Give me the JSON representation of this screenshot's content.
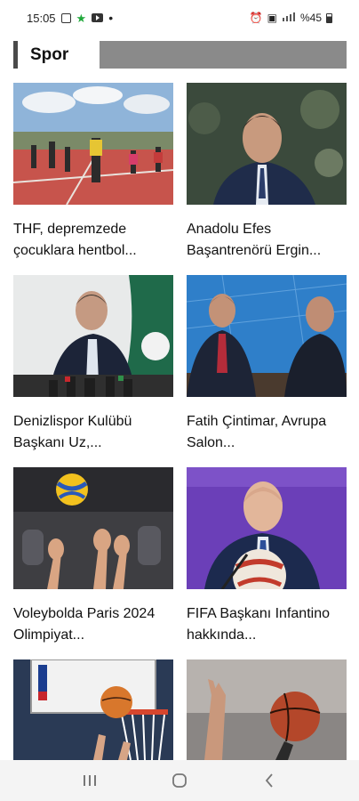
{
  "status_bar": {
    "time": "15:05",
    "battery": "%45",
    "icons": [
      "image-icon",
      "star-icon",
      "youtube-icon",
      "dot-icon",
      "alarm-icon",
      "vibrate-icon",
      "signal-icon",
      "battery-icon"
    ]
  },
  "section": {
    "title": "Spor"
  },
  "articles": [
    {
      "title": "THF, depremzede çocuklara hentbol...",
      "image": "children-playing-handball-court-photo"
    },
    {
      "title": "Anadolu Efes Başantrenörü Ergin...",
      "image": "basketball-coach-portrait-photo"
    },
    {
      "title": "Denizlispor Kulübü Başkanı Uz,...",
      "image": "club-president-press-conference-photo"
    },
    {
      "title": "Fatih Çintimar, Avrupa Salon...",
      "image": "tv-interview-studio-photo"
    },
    {
      "title": "Voleybolda Paris 2024 Olimpiyat...",
      "image": "volleyball-players-blocking-photo"
    },
    {
      "title": "FIFA Başkanı Infantino hakkında...",
      "image": "fifa-president-with-ball-photo"
    },
    {
      "title": "",
      "image": "basketball-hoop-photo"
    },
    {
      "title": "",
      "image": "basketball-players-hands-photo"
    }
  ],
  "nav": {
    "recent": "recent-apps-icon",
    "home": "home-icon",
    "back": "back-icon"
  },
  "colors": {
    "section_bar": "#4a4a4a",
    "section_fill": "#8a8a8a",
    "nav_bg": "#f4f4f4"
  }
}
